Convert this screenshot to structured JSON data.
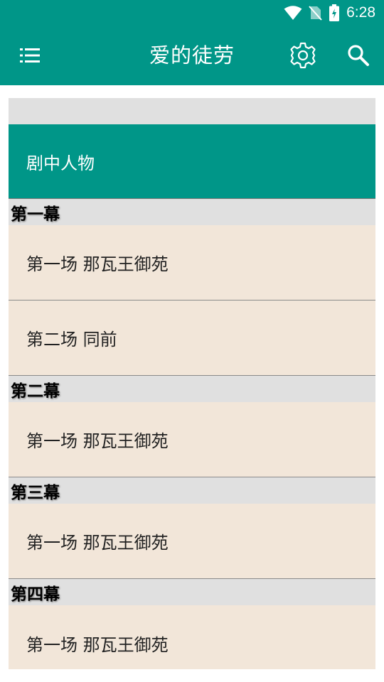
{
  "status_bar": {
    "time": "6:28",
    "icons": [
      "wifi-icon",
      "no-sim-icon",
      "battery-charging-icon"
    ]
  },
  "app_bar": {
    "title": "爱的徒劳",
    "icons": [
      "menu-icon",
      "gear-icon",
      "search-icon"
    ]
  },
  "colors": {
    "primary": "#009688",
    "section_bg": "#e0e0e0",
    "item_bg": "#f2e6d9"
  },
  "contents": {
    "cast_label": "剧中人物",
    "acts": [
      {
        "title": "第一幕",
        "scenes": [
          "第一场 那瓦王御苑",
          "第二场 同前"
        ]
      },
      {
        "title": "第二幕",
        "scenes": [
          "第一场 那瓦王御苑"
        ]
      },
      {
        "title": "第三幕",
        "scenes": [
          "第一场 那瓦王御苑"
        ]
      },
      {
        "title": "第四幕",
        "scenes": [
          "第一场 那瓦王御苑"
        ]
      }
    ]
  }
}
